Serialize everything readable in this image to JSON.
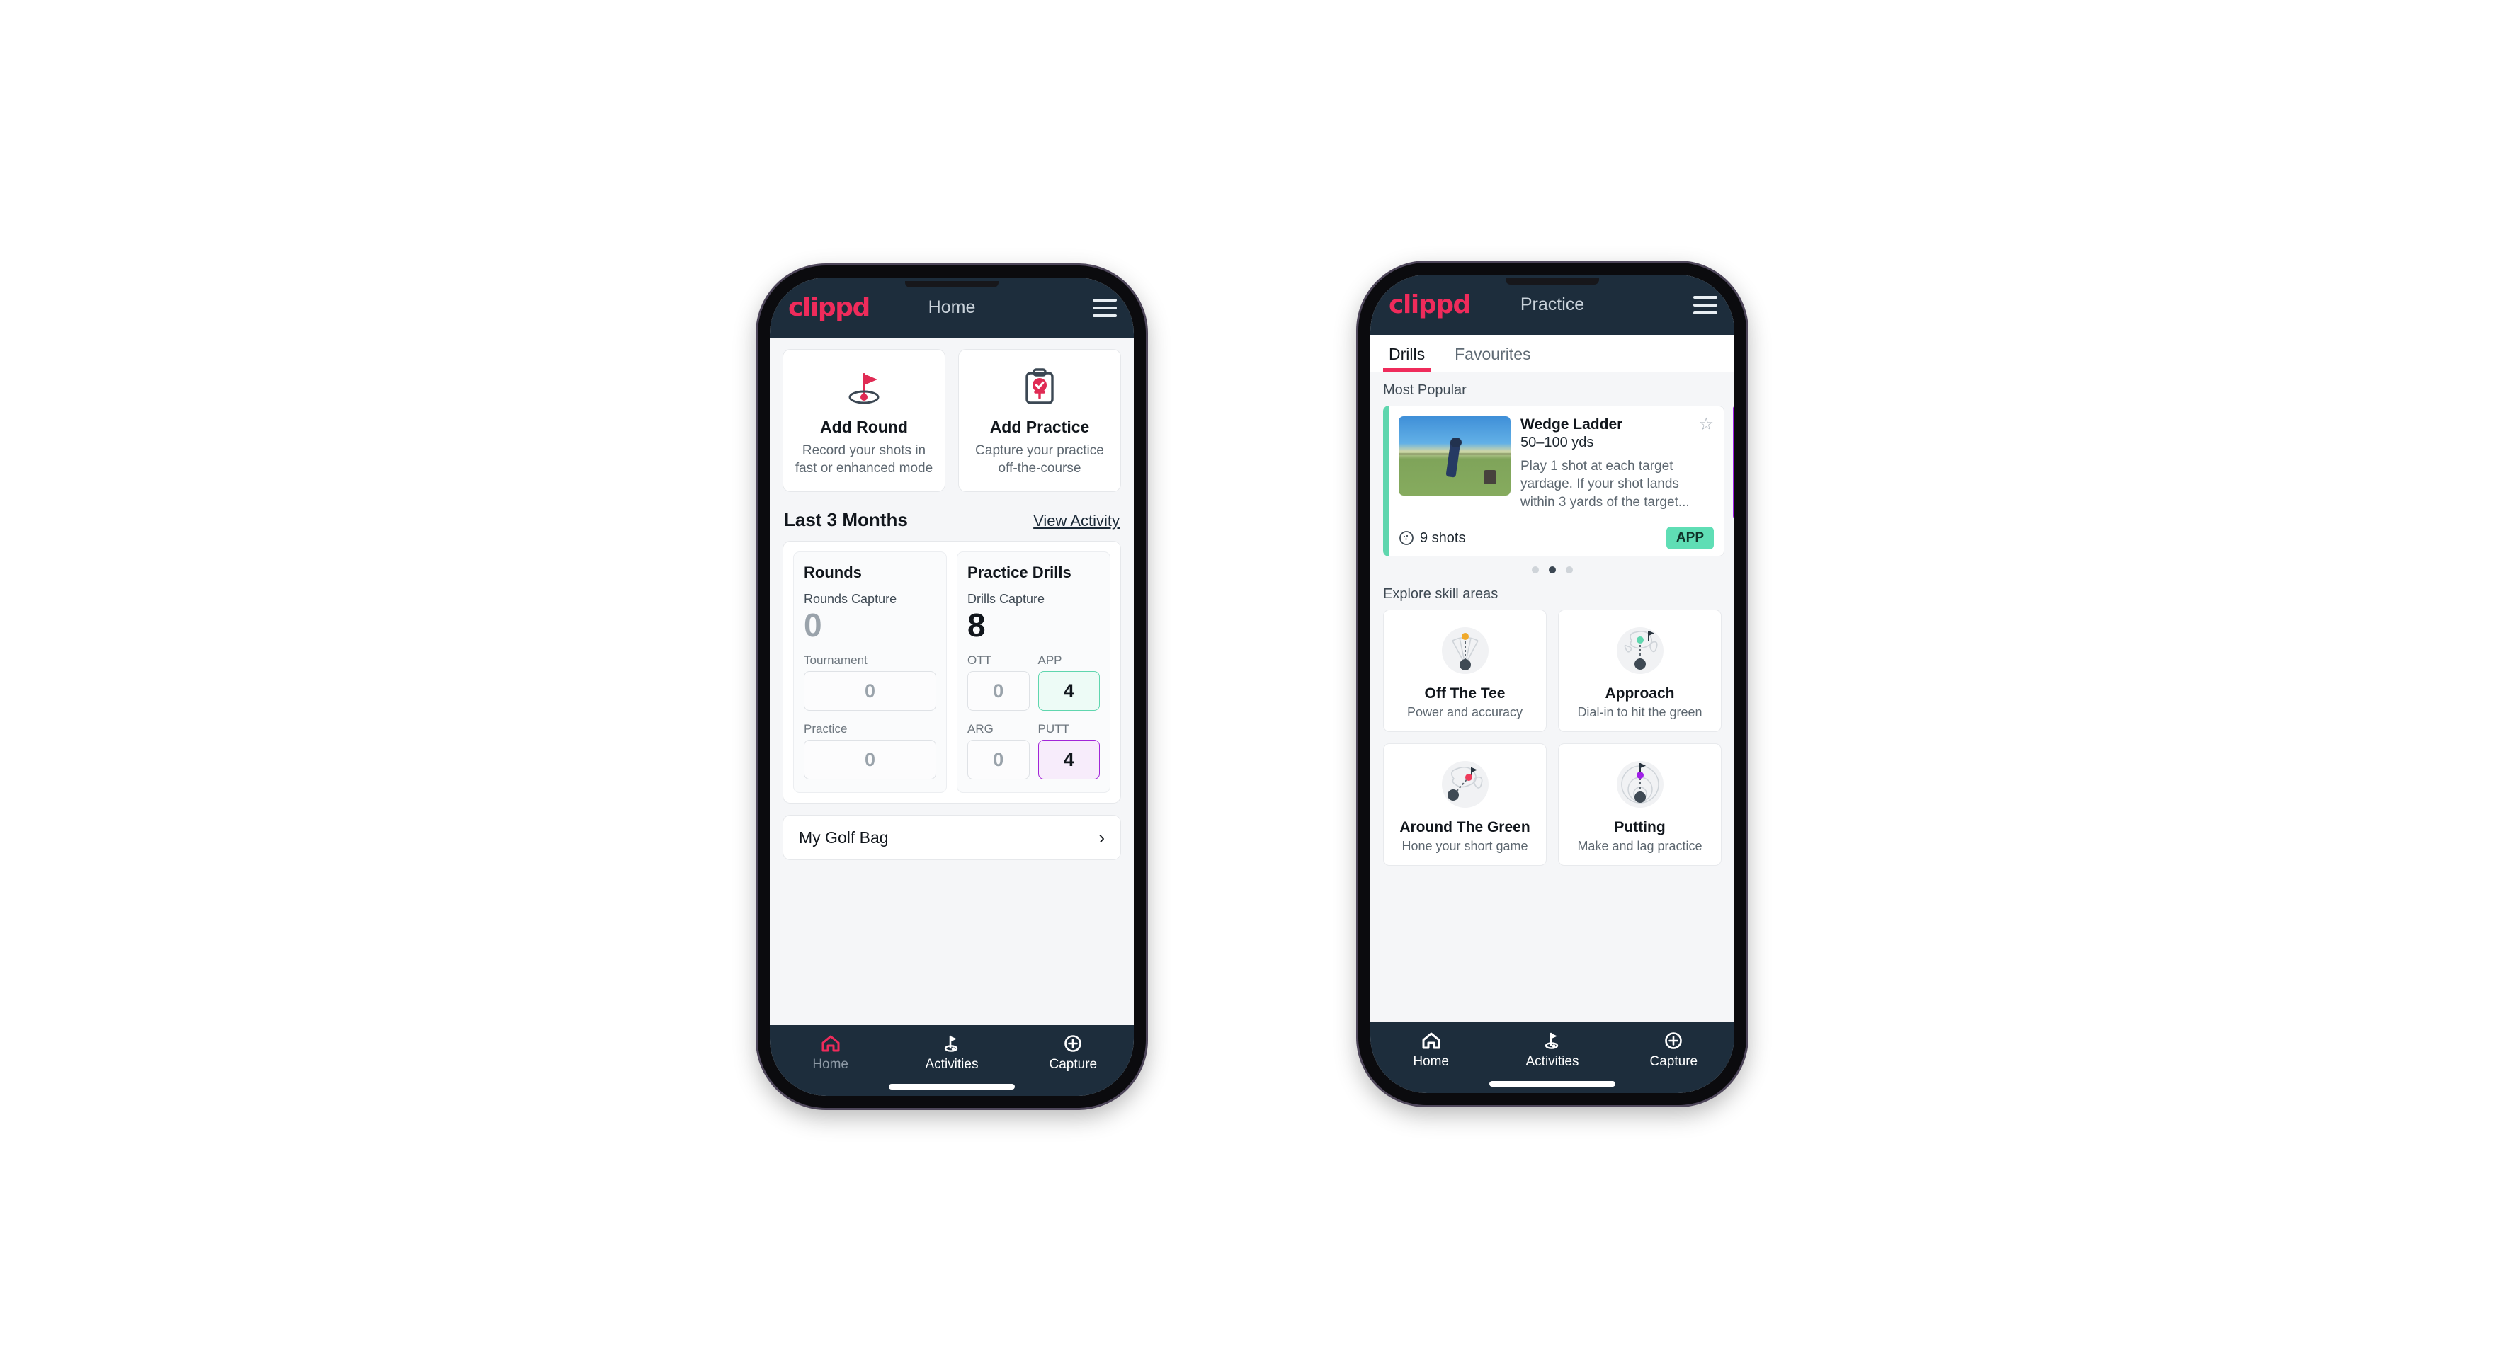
{
  "brand": {
    "name": "clippd",
    "accent": "#ef2b5b",
    "header_bg": "#1d2d3c"
  },
  "phone_home": {
    "appbar": {
      "logo": "clippd",
      "title": "Home",
      "menu_icon": "hamburger-menu-icon"
    },
    "action_cards": [
      {
        "icon": "golf-flag-hole-icon",
        "title": "Add Round",
        "subtitle_line1": "Record your shots in",
        "subtitle_line2": "fast or enhanced mode"
      },
      {
        "icon": "clipboard-check-tee-icon",
        "title": "Add Practice",
        "subtitle_line1": "Capture your practice",
        "subtitle_line2": "off-the-course"
      }
    ],
    "section": {
      "title": "Last 3 Months",
      "link": "View Activity"
    },
    "stats": {
      "rounds": {
        "title": "Rounds",
        "capture_label": "Rounds Capture",
        "capture_value": "0",
        "fields": [
          {
            "label": "Tournament",
            "value": "0",
            "style": "plain"
          },
          {
            "label": "Practice",
            "value": "0",
            "style": "plain"
          }
        ]
      },
      "drills": {
        "title": "Practice Drills",
        "capture_label": "Drills Capture",
        "capture_value": "8",
        "fields": [
          {
            "label": "OTT",
            "value": "0",
            "style": "plain"
          },
          {
            "label": "APP",
            "value": "4",
            "style": "green"
          },
          {
            "label": "ARG",
            "value": "0",
            "style": "plain"
          },
          {
            "label": "PUTT",
            "value": "4",
            "style": "purple"
          }
        ]
      }
    },
    "golf_bag": {
      "label": "My Golf Bag",
      "chevron": "chevron-right-icon"
    },
    "bottom_nav": [
      {
        "icon": "home-icon",
        "label": "Home",
        "active": true
      },
      {
        "icon": "golf-flag-icon",
        "label": "Activities",
        "active": false
      },
      {
        "icon": "plus-circle-icon",
        "label": "Capture",
        "active": false
      }
    ]
  },
  "phone_practice": {
    "appbar": {
      "logo": "clippd",
      "title": "Practice",
      "menu_icon": "hamburger-menu-icon"
    },
    "tabs": [
      {
        "label": "Drills",
        "active": true
      },
      {
        "label": "Favourites",
        "active": false
      }
    ],
    "most_popular": {
      "heading": "Most Popular",
      "drill": {
        "title": "Wedge Ladder",
        "yardage": "50–100 yds",
        "description": "Play 1 shot at each target yardage. If your shot lands within 3 yards of the target...",
        "shots": "9 shots",
        "shots_icon": "golf-ball-icon",
        "badge": "APP",
        "badge_color": "#5fdeb5",
        "favourite_icon": "star-outline-icon",
        "thumbnail": "golfer-wedge-practice-photo",
        "accent_stripe": "#5fd6ae",
        "next_card_stripe": "#a020e8"
      },
      "dots": {
        "count": 3,
        "active_index": 1
      }
    },
    "skill_areas": {
      "heading": "Explore skill areas",
      "cards": [
        {
          "icon": "off-the-tee-icon",
          "title": "Off The Tee",
          "subtitle": "Power and accuracy",
          "dot_color": "#f0a92b"
        },
        {
          "icon": "approach-icon",
          "title": "Approach",
          "subtitle": "Dial-in to hit the green",
          "dot_color": "#5fd6ae"
        },
        {
          "icon": "around-the-green-icon",
          "title": "Around The Green",
          "subtitle": "Hone your short game",
          "dot_color": "#ef3b5b"
        },
        {
          "icon": "putting-icon",
          "title": "Putting",
          "subtitle": "Make and lag practice",
          "dot_color": "#a020e8"
        }
      ]
    },
    "bottom_nav": [
      {
        "icon": "home-icon",
        "label": "Home",
        "active": false
      },
      {
        "icon": "golf-flag-icon",
        "label": "Activities",
        "active": false
      },
      {
        "icon": "plus-circle-icon",
        "label": "Capture",
        "active": false
      }
    ]
  }
}
